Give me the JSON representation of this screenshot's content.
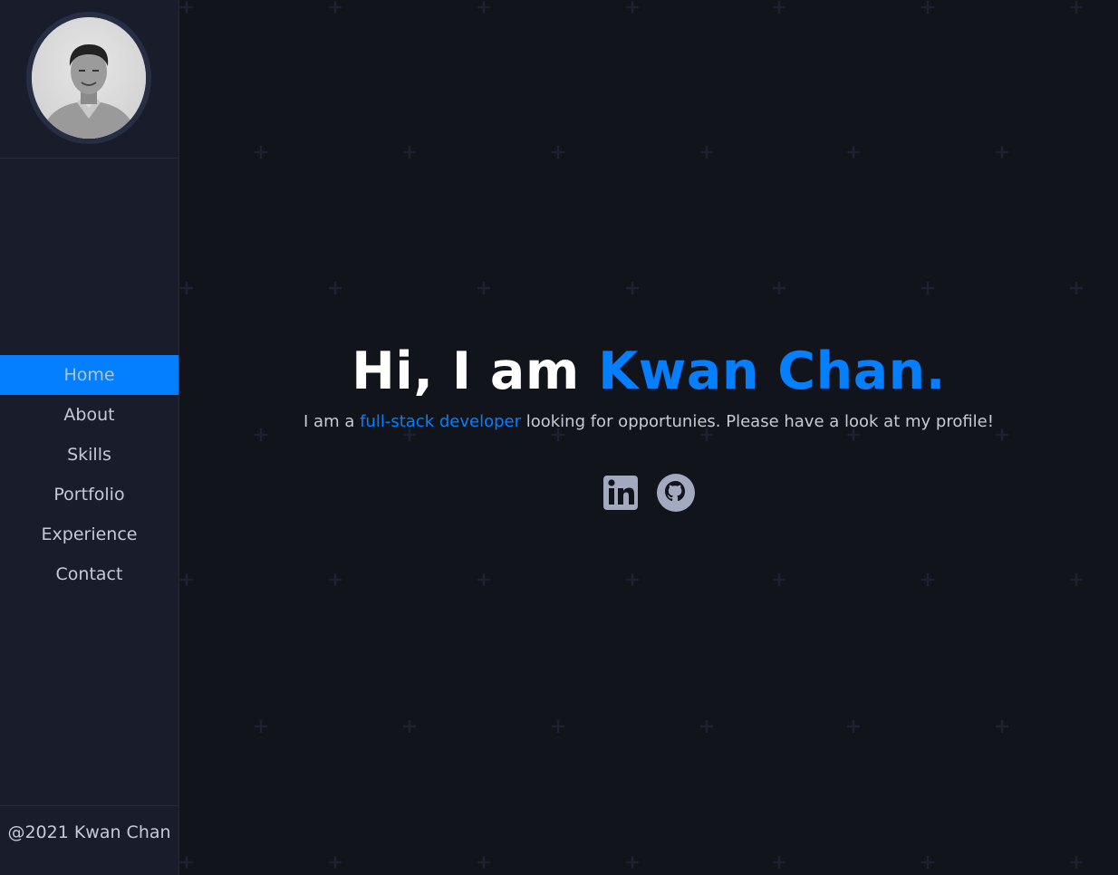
{
  "profile": {
    "photo_alt": "Kwan Chan portrait"
  },
  "nav": {
    "items": [
      {
        "label": "Home",
        "active": true
      },
      {
        "label": "About"
      },
      {
        "label": "Skills"
      },
      {
        "label": "Portfolio"
      },
      {
        "label": "Experience"
      },
      {
        "label": "Contact"
      }
    ]
  },
  "footer": {
    "text": "@2021 Kwan Chan"
  },
  "hero": {
    "greeting": "Hi, I am ",
    "name": "Kwan Chan.",
    "tagline_prefix": "I am a ",
    "tagline_role": "full-stack developer",
    "tagline_suffix": " looking for opportunies. Please have a look at my profile!"
  },
  "social": {
    "linkedin_icon": "linkedin-icon",
    "github_icon": "github-icon"
  },
  "colors": {
    "accent": "#037fff",
    "sidebar_bg": "#191d2b",
    "main_bg": "#12141b",
    "text": "#c6cad6"
  }
}
